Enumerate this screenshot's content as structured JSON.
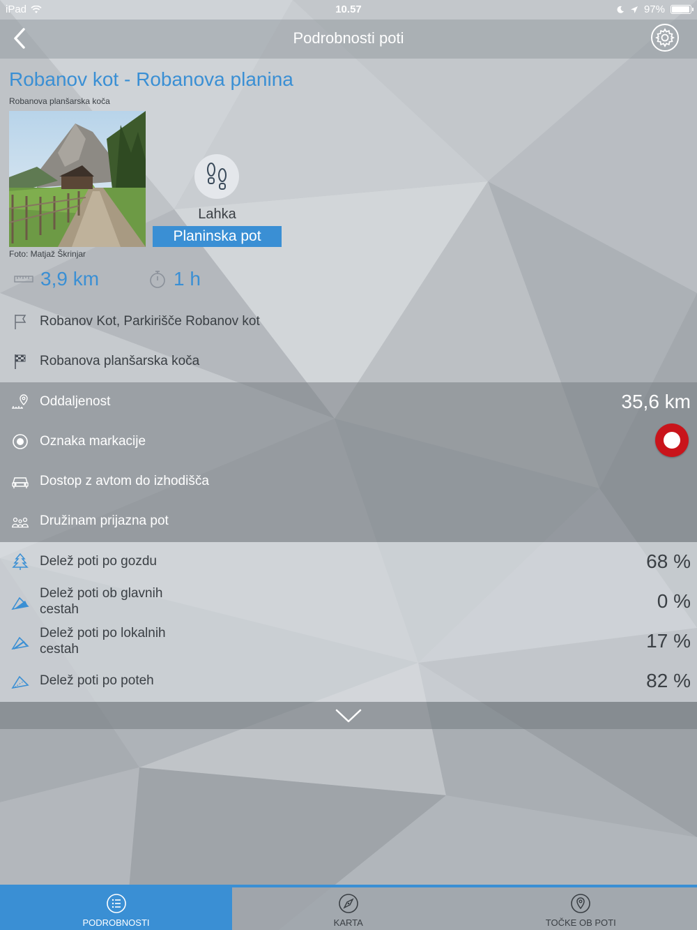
{
  "status_bar": {
    "device": "iPad",
    "time": "10.57",
    "battery": "97%",
    "battery_level": 0.97
  },
  "nav": {
    "title": "Podrobnosti poti",
    "back_icon": "chevron-left-icon",
    "settings_icon": "gear-icon"
  },
  "route": {
    "title": "Robanov kot - Robanova planina",
    "subtitle": "Robanova planšarska koča",
    "photo_credit": "Foto: Matjaž Škrinjar",
    "difficulty": "Lahka",
    "type": "Planinska pot",
    "distance": "3,9 km",
    "duration": "1 h",
    "start": "Robanov Kot, Parkirišče Robanov kot",
    "finish": "Robanova planšarska koča"
  },
  "info": {
    "distance_label": "Oddaljenost",
    "distance_value": "35,6 km",
    "marking_label": "Oznaka markacije",
    "car_access_label": "Dostop z avtom do izhodišča",
    "family_label": "Družinam prijazna pot"
  },
  "shares": [
    {
      "label": "Delež poti po gozdu",
      "value": "68 %"
    },
    {
      "label": "Delež poti ob glavnih cestah",
      "value": "0 %"
    },
    {
      "label": "Delež poti po lokalnih cestah",
      "value": "17 %"
    },
    {
      "label": "Delež poti po poteh",
      "value": "82 %"
    }
  ],
  "tabs": [
    {
      "label": "PODROBNOSTI",
      "icon": "list-icon",
      "active": true
    },
    {
      "label": "KARTA",
      "icon": "compass-icon",
      "active": false
    },
    {
      "label": "TOČKE OB POTI",
      "icon": "map-pin-icon",
      "active": false
    }
  ],
  "colors": {
    "accent": "#3a8fd4",
    "marker_red": "#c9141b"
  }
}
